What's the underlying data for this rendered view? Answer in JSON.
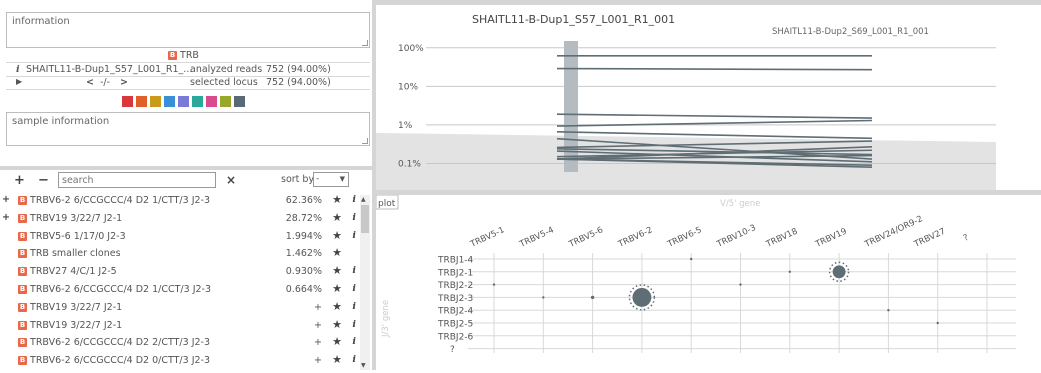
{
  "info_box": {
    "text": "information"
  },
  "locus_label": "TRB",
  "sample_row": {
    "name": "SHAITL11-B-Dup1_S57_L001_R1_...",
    "label": "analyzed reads",
    "value": "752 (94.00%)"
  },
  "nav_row": {
    "prev": "<",
    "mid": "-/-",
    "next": ">",
    "label": "selected locus",
    "value": "752 (94.00%)"
  },
  "swatches": [
    "#d9363e",
    "#e0602a",
    "#c99a1c",
    "#3a8fd9",
    "#7a7ad9",
    "#2aa89a",
    "#d94a8f",
    "#98a82a",
    "#5a6a75"
  ],
  "sample_info": {
    "text": "sample information"
  },
  "toolbar": {
    "plus": "+",
    "minus": "−",
    "search_placeholder": "search",
    "clear": "×",
    "sort_label": "sort by",
    "sort_value": "-"
  },
  "clones": [
    {
      "expand": "+",
      "badge": "B",
      "name": "TRBV6-2 6/CCGCCC/4 D2 1/CTT/3 J2-3",
      "size": "62.36%",
      "star": "★",
      "info": "i"
    },
    {
      "expand": "+",
      "badge": "B",
      "name": "TRBV19 3/22/7 J2-1",
      "size": "28.72%",
      "star": "★",
      "info": "i"
    },
    {
      "expand": "",
      "badge": "B",
      "name": "TRBV5-6 1/17/0 J2-3",
      "size": "1.994%",
      "star": "★",
      "info": "i"
    },
    {
      "expand": "",
      "badge": "B",
      "name": "TRB smaller clones",
      "size": "1.462%",
      "star": "★",
      "info": ""
    },
    {
      "expand": "",
      "badge": "B",
      "name": "TRBV27 4/C/1 J2-5",
      "size": "0.930%",
      "star": "★",
      "info": "i"
    },
    {
      "expand": "",
      "badge": "B",
      "name": "TRBV6-2 6/CCGCCC/4 D2 1/CCT/3 J2-3",
      "size": "0.664%",
      "star": "★",
      "info": "i"
    },
    {
      "expand": "",
      "badge": "B",
      "name": "TRBV19 3/22/7 J2-1",
      "size": "+",
      "star": "★",
      "info": "i"
    },
    {
      "expand": "",
      "badge": "B",
      "name": "TRBV19 3/22/7 J2-1",
      "size": "+",
      "star": "★",
      "info": "i"
    },
    {
      "expand": "",
      "badge": "B",
      "name": "TRBV6-2 6/CCGCCC/4 D2 2/CTT/3 J2-3",
      "size": "+",
      "star": "★",
      "info": "i"
    },
    {
      "expand": "",
      "badge": "B",
      "name": "TRBV6-2 6/CCGCCC/4 D2 0/CTT/3 J2-3",
      "size": "+",
      "star": "★",
      "info": "i"
    }
  ],
  "graph": {
    "sample1": "SHAITL11-B-Dup1_S57_L001_R1_001",
    "sample2": "SHAITL11-B-Dup2_S69_L001_R1_001",
    "y_ticks": [
      "100%",
      "10%",
      "1%",
      "0.1%"
    ]
  },
  "plot": {
    "tab_label": "plot",
    "x_axis_label": "V/5' gene",
    "y_axis_label": "J/3' gene",
    "v_genes": [
      "TRBV5-1",
      "TRBV5-4",
      "TRBV5-6",
      "TRBV6-2",
      "TRBV6-5",
      "TRBV10-3",
      "TRBV18",
      "TRBV19",
      "TRBV24/OR9-2",
      "TRBV27",
      "?"
    ],
    "j_genes": [
      "TRBJ1-4",
      "TRBJ2-1",
      "TRBJ2-2",
      "TRBJ2-3",
      "TRBJ2-4",
      "TRBJ2-5",
      "TRBJ2-6",
      "?"
    ]
  },
  "chart_data": {
    "type": "line",
    "x": [
      "SHAITL11-B-Dup1_S57_L001_R1_001",
      "SHAITL11-B-Dup2_S69_L001_R1_001"
    ],
    "y_scale": "log",
    "ylim": [
      0.0006,
      1.5
    ],
    "series": [
      {
        "values": [
          0.62,
          0.62
        ]
      },
      {
        "values": [
          0.29,
          0.27
        ]
      },
      {
        "values": [
          0.019,
          0.015
        ]
      },
      {
        "values": [
          0.0093,
          0.013
        ]
      },
      {
        "values": [
          0.0066,
          0.0045
        ]
      },
      {
        "values": [
          0.0044,
          0.0013
        ]
      },
      {
        "values": [
          0.0026,
          0.0038
        ]
      },
      {
        "values": [
          0.0024,
          0.0017
        ]
      },
      {
        "values": [
          0.0021,
          0.0011
        ]
      },
      {
        "values": [
          0.0015,
          0.0022
        ]
      },
      {
        "values": [
          0.0013,
          0.0027
        ]
      },
      {
        "values": [
          0.0013,
          0.0008
        ]
      },
      {
        "values": [
          0.0013,
          0.0016
        ]
      },
      {
        "values": [
          0.0013,
          0.0009
        ]
      }
    ]
  },
  "bubbles": [
    {
      "v": "TRBV6-2",
      "j": "TRBJ2-3",
      "size": 0.62
    },
    {
      "v": "TRBV19",
      "j": "TRBJ2-1",
      "size": 0.29
    },
    {
      "v": "TRBV5-6",
      "j": "TRBJ2-3",
      "size": 0.02
    },
    {
      "v": "TRBV27",
      "j": "TRBJ2-5",
      "size": 0.009
    },
    {
      "v": "TRBV5-1",
      "j": "TRBJ2-2",
      "size": 0.002
    },
    {
      "v": "TRBV5-4",
      "j": "TRBJ2-3",
      "size": 0.002
    },
    {
      "v": "TRBV6-5",
      "j": "TRBJ1-4",
      "size": 0.002
    },
    {
      "v": "TRBV10-3",
      "j": "TRBJ2-2",
      "size": 0.002
    },
    {
      "v": "TRBV18",
      "j": "TRBJ2-1",
      "size": 0.002
    },
    {
      "v": "TRBV24/OR9-2",
      "j": "TRBJ2-4",
      "size": 0.002
    }
  ]
}
